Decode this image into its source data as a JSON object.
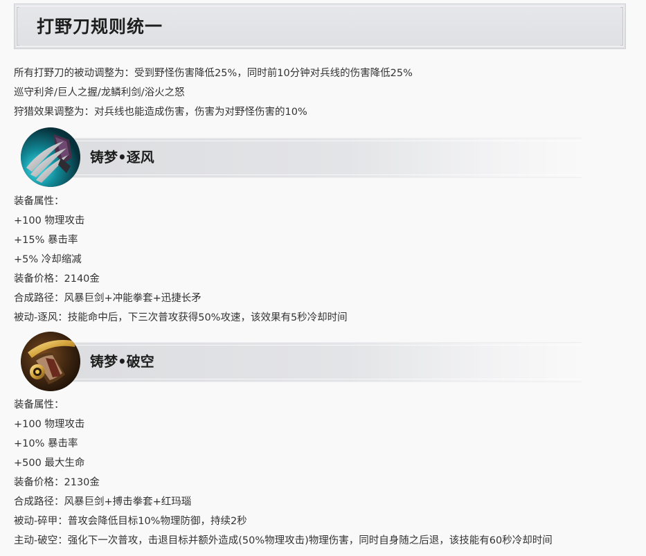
{
  "section": {
    "title": "打野刀规则统一"
  },
  "intro": [
    "所有打野刀的被动调整为：受到野怪伤害降低25%，同时前10分钟对兵线的伤害降低25%",
    "巡守利斧/巨人之握/龙鳞利剑/浴火之怒",
    "狩猎效果调整为：对兵线也能造成伤害，伤害为对野怪伤害的10%"
  ],
  "items": [
    {
      "name": "铸梦•逐风",
      "icon": "claw-blade-icon",
      "icon_color": "#1fb7c4",
      "lines": [
        "装备属性：",
        "+100 物理攻击",
        "+15% 暴击率",
        "+5% 冷却缩减",
        "装备价格：2140金",
        "合成路径：风暴巨剑+冲能拳套+迅捷长矛",
        "被动-逐风：技能命中后，下三次普攻获得50%攻速，该效果有5秒冷却时间"
      ]
    },
    {
      "name": "铸梦•破空",
      "icon": "golden-blade-icon",
      "icon_color": "#c9a040",
      "lines": [
        "装备属性：",
        "+100 物理攻击",
        "+10% 暴击率",
        "+500 最大生命",
        "装备价格：2130金",
        "合成路径：风暴巨剑+搏击拳套+红玛瑙",
        "被动-碎甲：普攻会降低目标10%物理防御，持续2秒",
        "主动-破空：强化下一次普攻，击退目标并额外造成(50%物理攻击)物理伤害，同时自身随之后退，该技能有60秒冷却时间"
      ]
    }
  ]
}
